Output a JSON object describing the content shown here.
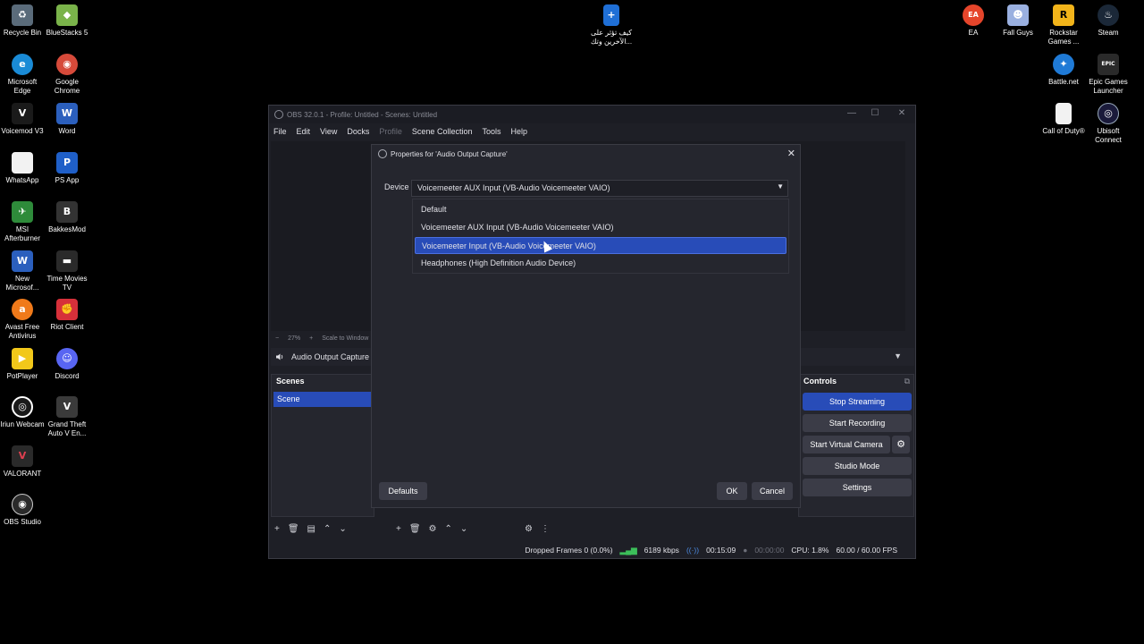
{
  "desktop": {
    "icons": [
      {
        "label": "Recycle Bin",
        "icon": "recycle-bin-icon",
        "color": "#5a6b7a",
        "glyph": "♻"
      },
      {
        "label": "BlueStacks 5",
        "icon": "bluestacks-icon",
        "color": "#7ab34a",
        "glyph": "◆"
      },
      {
        "label": "Microsoft Edge",
        "icon": "edge-icon",
        "color": "#1a8bd6",
        "glyph": "e"
      },
      {
        "label": "Google Chrome",
        "icon": "chrome-icon",
        "color": "#d64a3a",
        "glyph": "◉"
      },
      {
        "label": "Voicemod V3",
        "icon": "voicemod-icon",
        "color": "#1a1a1a",
        "glyph": "V"
      },
      {
        "label": "Word",
        "icon": "word-icon",
        "color": "#2b5fbd",
        "glyph": "W"
      },
      {
        "label": "WhatsApp",
        "icon": "whatsapp-file-icon",
        "color": "#f2f2f2",
        "glyph": ""
      },
      {
        "label": "PS App",
        "icon": "ps-app-icon",
        "color": "#1f5fc8",
        "glyph": "P"
      },
      {
        "label": "MSI Afterburner",
        "icon": "msi-afterburner-icon",
        "color": "#2e8b3a",
        "glyph": "✈"
      },
      {
        "label": "BakkesMod",
        "icon": "bakkesmod-icon",
        "color": "#333333",
        "glyph": "B"
      },
      {
        "label": "New Microsof...",
        "icon": "word-doc-icon",
        "color": "#2b5fbd",
        "glyph": "W"
      },
      {
        "label": "Time Movies TV",
        "icon": "time-movies-icon",
        "color": "#2a2a2a",
        "glyph": "▬"
      },
      {
        "label": "Avast Free Antivirus",
        "icon": "avast-icon",
        "color": "#f07a1a",
        "glyph": "a"
      },
      {
        "label": "Riot Client",
        "icon": "riot-client-icon",
        "color": "#d6303a",
        "glyph": "✊"
      },
      {
        "label": "PotPlayer",
        "icon": "potplayer-icon",
        "color": "#f2c81a",
        "glyph": "▶"
      },
      {
        "label": "Discord",
        "icon": "discord-icon",
        "color": "#5865f2",
        "glyph": "☺"
      },
      {
        "label": "Iriun Webcam",
        "icon": "iriun-webcam-icon",
        "color": "#1a1a1a",
        "glyph": "◎"
      },
      {
        "label": "Grand Theft Auto V En...",
        "icon": "gta-v-icon",
        "color": "#3a3a3a",
        "glyph": "V"
      },
      {
        "label": "VALORANT",
        "icon": "valorant-icon",
        "color": "#2a2a2a",
        "glyph": "V"
      },
      {
        "label": "OBS Studio",
        "icon": "obs-studio-icon",
        "color": "#2a2a2a",
        "glyph": "◉"
      },
      {
        "label": "كيف تؤثر على الآخرين وتك...",
        "icon": "document-icon",
        "color": "#1f6fd6",
        "glyph": "+"
      },
      {
        "label": "EA",
        "icon": "ea-icon",
        "color": "#e5452b",
        "glyph": "EA"
      },
      {
        "label": "Fall Guys",
        "icon": "fall-guys-icon",
        "color": "#9ab0e0",
        "glyph": "☻"
      },
      {
        "label": "Rockstar Games ...",
        "icon": "rockstar-icon",
        "color": "#f2b41a",
        "glyph": "R"
      },
      {
        "label": "Steam",
        "icon": "steam-icon",
        "color": "#1b2838",
        "glyph": "♨"
      },
      {
        "label": "Battle.net",
        "icon": "battlenet-icon",
        "color": "#1f7ad6",
        "glyph": "✦"
      },
      {
        "label": "Epic Games Launcher",
        "icon": "epic-games-icon",
        "color": "#2a2a2a",
        "glyph": "EPIC"
      },
      {
        "label": "Call of Duty®",
        "icon": "cod-file-icon",
        "color": "#f2f2f2",
        "glyph": ""
      },
      {
        "label": "Ubisoft Connect",
        "icon": "ubisoft-icon",
        "color": "#1a1a3a",
        "glyph": "◎"
      }
    ]
  },
  "obs": {
    "title": "OBS 32.0.1 - Profile: Untitled - Scenes: Untitled",
    "menu": [
      "File",
      "Edit",
      "View",
      "Docks",
      "Profile",
      "Scene Collection",
      "Tools",
      "Help"
    ],
    "zoom": {
      "minus": "−",
      "value": "27%",
      "plus": "+",
      "scale": "Scale to Window"
    },
    "source_name": "Audio Output Capture",
    "scenes": {
      "header": "Scenes",
      "items": [
        "Scene"
      ]
    },
    "controls": {
      "header": "Controls",
      "stop_streaming": "Stop Streaming",
      "start_recording": "Start Recording",
      "start_virtual_camera": "Start Virtual Camera",
      "studio_mode": "Studio Mode",
      "settings": "Settings"
    },
    "status": {
      "dropped": "Dropped Frames 0 (0.0%)",
      "bitrate": "6189 kbps",
      "stream_time": "00:15:09",
      "rec_time": "00:00:00",
      "cpu": "CPU: 1.8%",
      "fps": "60.00 / 60.00 FPS"
    }
  },
  "dialog": {
    "title": "Properties for 'Audio Output Capture'",
    "device_label": "Device",
    "device_value": "Voicemeeter AUX Input (VB-Audio Voicemeeter VAIO)",
    "options": [
      "Default",
      "Voicemeeter AUX Input (VB-Audio Voicemeeter VAIO)",
      "Voicemeeter Input (VB-Audio Voicemeeter VAIO)",
      "Headphones (High Definition Audio Device)"
    ],
    "selected_index": 2,
    "defaults_btn": "Defaults",
    "ok_btn": "OK",
    "cancel_btn": "Cancel"
  },
  "colors": {
    "accent": "#284cb8",
    "bg": "#25262e"
  }
}
